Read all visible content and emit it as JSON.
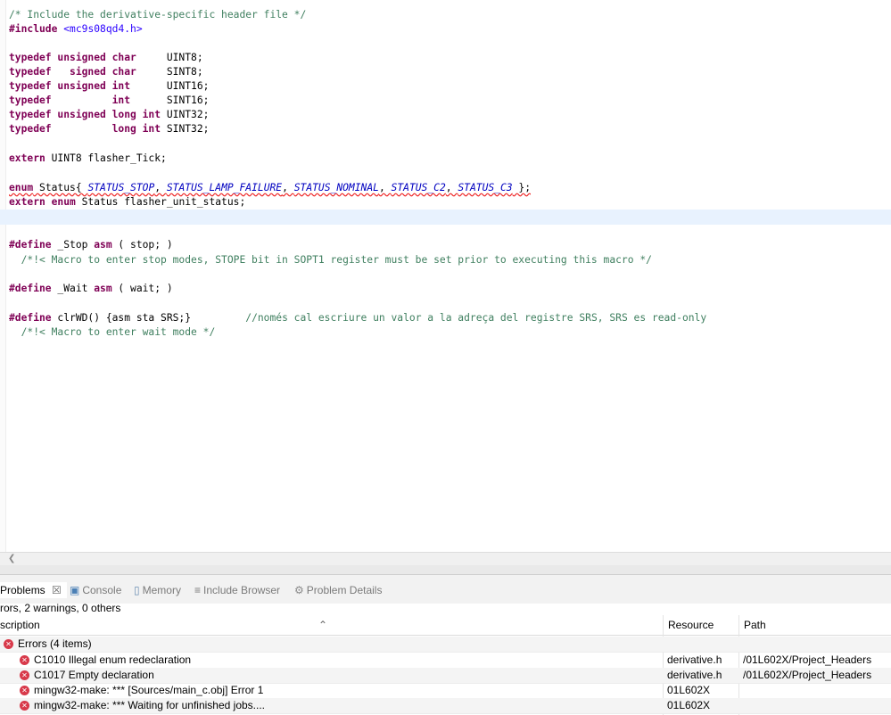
{
  "editor": {
    "lines": {
      "l1": "/* Include the derivative-specific header file */",
      "l2_kw": "#include",
      "l2_inc": "<mc9s08qd4.h>",
      "l3": {
        "kw": "typedef unsigned char",
        "rest": "     UINT8;"
      },
      "l4": {
        "kw1": "typedef",
        "kw2": "signed char",
        "rest": "     SINT8;"
      },
      "l5": {
        "kw": "typedef unsigned int",
        "rest": "      UINT16;"
      },
      "l6": {
        "kw1": "typedef",
        "kw2": "int",
        "rest": "      SINT16;"
      },
      "l7": {
        "kw": "typedef unsigned long int",
        "rest": " UINT32;"
      },
      "l8": {
        "kw1": "typedef",
        "kw2": "long int",
        "rest": " SINT32;"
      },
      "l9": {
        "kw": "extern",
        "rest": " UINT8 flasher_Tick;"
      },
      "l10": {
        "kw": "enum",
        "name": " Status{ ",
        "e1": "STATUS_STOP",
        "e2": "STATUS_LAMP_FAILURE",
        "e3": "STATUS_NOMINAL",
        "e4": "STATUS_C2",
        "e5": "STATUS_C3",
        "end": " };"
      },
      "l11": {
        "kw": "extern enum",
        "rest": " Status flasher_unit_status;"
      },
      "l12": {
        "kw": "#define",
        "mid": " _Stop ",
        "kw2": "asm",
        "rest": " ( stop; )"
      },
      "l13": "  /*!< Macro to enter stop modes, STOPE bit in SOPT1 register must be set prior to executing this macro */",
      "l14": {
        "kw": "#define",
        "mid": " _Wait ",
        "kw2": "asm",
        "rest": " ( wait; )"
      },
      "l15": {
        "kw": "#define",
        "rest": " clrWD() {asm sta SRS;}",
        "comment": "//només cal escriure un valor a la adreça del registre SRS, SRS es read-only"
      },
      "l16": "  /*!< Macro to enter wait mode */"
    }
  },
  "panel": {
    "tabs": [
      "Problems",
      "Console",
      "Memory",
      "Include Browser",
      "Problem Details"
    ],
    "summary": "rors, 2 warnings, 0 others",
    "columns": {
      "description": "scription",
      "resource": "Resource",
      "path": "Path"
    },
    "group": "Errors (4 items)",
    "rows": [
      {
        "description": "C1010 Illegal enum redeclaration",
        "resource": "derivative.h",
        "path": "/01L602X/Project_Headers"
      },
      {
        "description": "C1017 Empty declaration",
        "resource": "derivative.h",
        "path": "/01L602X/Project_Headers"
      },
      {
        "description": "mingw32-make: *** [Sources/main_c.obj] Error 1",
        "resource": "01L602X",
        "path": ""
      },
      {
        "description": "mingw32-make: *** Waiting for unfinished jobs....",
        "resource": "01L602X",
        "path": ""
      }
    ]
  },
  "colors": {
    "keyword": "#7f0055",
    "comment": "#3f7f5f",
    "include": "#2a00ff",
    "enum_const": "#0000c0",
    "error": "#d8394a",
    "current_line": "#e8f2fe"
  },
  "icons": [
    "close-icon",
    "console-icon",
    "memory-icon",
    "include-browser-icon",
    "problem-details-icon",
    "error-icon",
    "sort-caret-icon",
    "scroll-left-icon"
  ]
}
